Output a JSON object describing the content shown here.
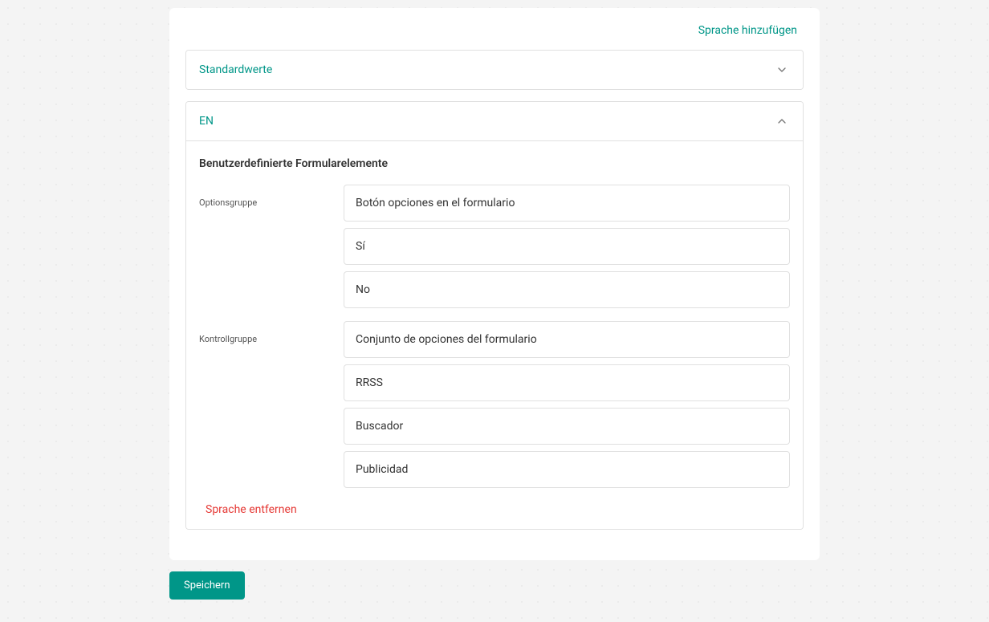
{
  "header": {
    "add_language_label": "Sprache hinzufügen"
  },
  "accordions": {
    "defaults": {
      "title": "Standardwerte"
    },
    "en": {
      "title": "EN",
      "section_title": "Benutzerdefinierte Formularelemente",
      "groups": {
        "optionsgruppe": {
          "label": "Optionsgruppe",
          "fields": [
            "Botón opciones en el formulario",
            "Sí",
            "No"
          ]
        },
        "kontrollgruppe": {
          "label": "Kontrollgruppe",
          "fields": [
            "Conjunto de opciones del formulario",
            "RRSS",
            "Buscador",
            "Publicidad"
          ]
        }
      },
      "remove_language_label": "Sprache entfernen"
    }
  },
  "footer": {
    "save_label": "Speichern"
  }
}
